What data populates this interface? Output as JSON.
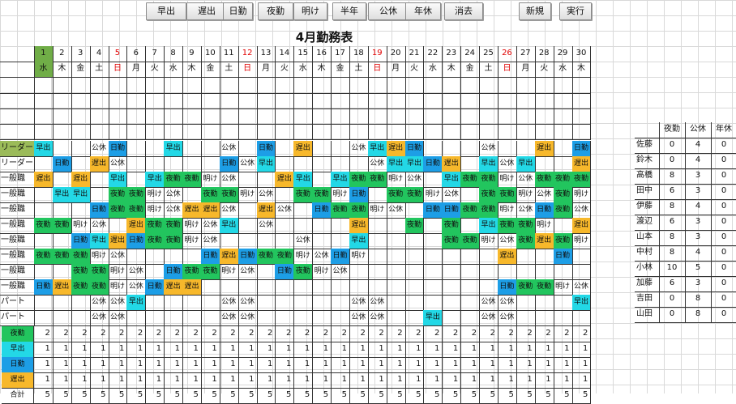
{
  "toolbar": {
    "buttons": [
      "早出",
      "遅出",
      "日勤",
      "夜勤",
      "明け",
      "半年",
      "公休",
      "年休",
      "消去",
      "新規",
      "実行"
    ]
  },
  "title": "4月勤務表",
  "days": [
    {
      "d": "1",
      "w": "水"
    },
    {
      "d": "2",
      "w": "木"
    },
    {
      "d": "3",
      "w": "金"
    },
    {
      "d": "4",
      "w": "土"
    },
    {
      "d": "5",
      "w": "日"
    },
    {
      "d": "6",
      "w": "月"
    },
    {
      "d": "7",
      "w": "火"
    },
    {
      "d": "8",
      "w": "水"
    },
    {
      "d": "9",
      "w": "木"
    },
    {
      "d": "10",
      "w": "金"
    },
    {
      "d": "11",
      "w": "土"
    },
    {
      "d": "12",
      "w": "日"
    },
    {
      "d": "13",
      "w": "月"
    },
    {
      "d": "14",
      "w": "火"
    },
    {
      "d": "15",
      "w": "水"
    },
    {
      "d": "16",
      "w": "木"
    },
    {
      "d": "17",
      "w": "金"
    },
    {
      "d": "18",
      "w": "土"
    },
    {
      "d": "19",
      "w": "日"
    },
    {
      "d": "20",
      "w": "月"
    },
    {
      "d": "21",
      "w": "火"
    },
    {
      "d": "22",
      "w": "水"
    },
    {
      "d": "23",
      "w": "木"
    },
    {
      "d": "24",
      "w": "金"
    },
    {
      "d": "25",
      "w": "土"
    },
    {
      "d": "26",
      "w": "日"
    },
    {
      "d": "27",
      "w": "月"
    },
    {
      "d": "28",
      "w": "火"
    },
    {
      "d": "29",
      "w": "水"
    },
    {
      "d": "30",
      "w": "木"
    }
  ],
  "colors": {
    "夜勤": "#22c55e",
    "早出": "#23d8e6",
    "日勤": "#1d9ee6",
    "遅出": "#f7b82b",
    "today": "#70ad47",
    "leader": "#9bbb59",
    "sunday": "#e00000"
  },
  "staff": [
    {
      "role": "リーダー",
      "shifts": [
        "早出",
        "",
        "",
        "公休",
        "日勤",
        "",
        "",
        "早出",
        "",
        "",
        "公休",
        "",
        "日勤",
        "",
        "遅出",
        "",
        "",
        "公休",
        "早出",
        "遅出",
        "日勤",
        "",
        "",
        "",
        "公休",
        "",
        "",
        "遅出",
        "",
        "日勤"
      ]
    },
    {
      "role": "リーダー",
      "shifts": [
        "",
        "日勤",
        "",
        "遅出",
        "公休",
        "",
        "",
        "",
        "",
        "",
        "日勤",
        "公休",
        "早出",
        "",
        "",
        "",
        "",
        "",
        "公休",
        "早出",
        "早出",
        "日勤",
        "遅出",
        "",
        "早出",
        "公休",
        "早出",
        "",
        "",
        "遅出"
      ]
    },
    {
      "role": "一般職",
      "shifts": [
        "遅出",
        "",
        "遅出",
        "",
        "早出",
        "",
        "早出",
        "夜勤",
        "夜勤",
        "明け",
        "公休",
        "",
        "",
        "遅出",
        "早出",
        "",
        "早出",
        "夜勤",
        "夜勤",
        "明け",
        "公休",
        "",
        "早出",
        "夜勤",
        "夜勤",
        "明け",
        "公休",
        "夜勤",
        "夜勤",
        "夜勤"
      ]
    },
    {
      "role": "一般職",
      "shifts": [
        "",
        "早出",
        "早出",
        "",
        "夜勤",
        "夜勤",
        "明け",
        "公休",
        "",
        "夜勤",
        "夜勤",
        "明け",
        "公休",
        "",
        "夜勤",
        "夜勤",
        "明け",
        "日勤",
        "",
        "夜勤",
        "夜勤",
        "明け",
        "公休",
        "",
        "夜勤",
        "夜勤",
        "明け",
        "公休",
        "夜勤",
        "明け"
      ]
    },
    {
      "role": "一般職",
      "shifts": [
        "",
        "",
        "",
        "日勤",
        "夜勤",
        "夜勤",
        "明け",
        "公休",
        "遅出",
        "遅出",
        "公休",
        "",
        "遅出",
        "公休",
        "",
        "日勤",
        "夜勤",
        "夜勤",
        "明け",
        "公休",
        "",
        "日勤",
        "日勤",
        "夜勤",
        "夜勤",
        "明け",
        "公休",
        "日勤",
        "夜勤",
        "公休"
      ]
    },
    {
      "role": "一般職",
      "shifts": [
        "夜勤",
        "夜勤",
        "明け",
        "公休",
        "",
        "遅出",
        "夜勤",
        "夜勤",
        "明け",
        "公休",
        "早出",
        "",
        "公休",
        "",
        "",
        "",
        "",
        "遅出",
        "",
        "",
        "夜勤",
        "",
        "夜勤",
        "",
        "早出",
        "夜勤",
        "夜勤",
        "明け",
        "",
        "遅出"
      ]
    },
    {
      "role": "一般職",
      "shifts": [
        "",
        "",
        "日勤",
        "早出",
        "遅出",
        "日勤",
        "夜勤",
        "夜勤",
        "明け",
        "公休",
        "",
        "",
        "",
        "",
        "公休",
        "",
        "",
        "早出",
        "",
        "",
        "",
        "",
        "夜勤",
        "夜勤",
        "明け",
        "公休",
        "夜勤",
        "遅出",
        "夜勤",
        "明け"
      ]
    },
    {
      "role": "一般職",
      "shifts": [
        "夜勤",
        "夜勤",
        "夜勤",
        "明け",
        "公休",
        "",
        "",
        "",
        "",
        "日勤",
        "遅出",
        "日勤",
        "夜勤",
        "夜勤",
        "明け",
        "公休",
        "日勤",
        "明け",
        "",
        "",
        "",
        "",
        "",
        "",
        "",
        "遅出",
        "",
        "",
        "日勤",
        ""
      ]
    },
    {
      "role": "一般職",
      "shifts": [
        "",
        "",
        "夜勤",
        "夜勤",
        "明け",
        "公休",
        "",
        "日勤",
        "夜勤",
        "夜勤",
        "明け",
        "公休",
        "",
        "日勤",
        "夜勤",
        "明け",
        "公休",
        "",
        "",
        "",
        "",
        "",
        "",
        "",
        "",
        "",
        "",
        "",
        "",
        ""
      ]
    },
    {
      "role": "一般職",
      "shifts": [
        "日勤",
        "遅出",
        "夜勤",
        "夜勤",
        "明け",
        "公休",
        "日勤",
        "遅出",
        "遅出",
        "",
        "",
        "",
        "",
        "",
        "",
        "",
        "",
        "",
        "",
        "",
        "",
        "",
        "",
        "",
        "",
        "日勤",
        "夜勤",
        "夜勤",
        "明け",
        "公休"
      ]
    },
    {
      "role": "パート",
      "shifts": [
        "",
        "",
        "",
        "公休",
        "公休",
        "早出",
        "",
        "",
        "",
        "",
        "公休",
        "公休",
        "",
        "",
        "",
        "",
        "",
        "公休",
        "公休",
        "",
        "",
        "",
        "",
        "",
        "公休",
        "公休",
        "",
        "",
        "",
        "早出"
      ]
    },
    {
      "role": "パート",
      "shifts": [
        "",
        "",
        "",
        "公休",
        "公休",
        "",
        "",
        "",
        "",
        "",
        "公休",
        "公休",
        "",
        "",
        "",
        "",
        "",
        "公休",
        "公休",
        "",
        "",
        "早出",
        "",
        "",
        "公休",
        "公休",
        "",
        "",
        "",
        ""
      ]
    }
  ],
  "summary": [
    {
      "label": "夜勤",
      "values": [
        "2",
        "2",
        "2",
        "2",
        "2",
        "2",
        "2",
        "2",
        "2",
        "2",
        "2",
        "2",
        "2",
        "2",
        "2",
        "2",
        "2",
        "2",
        "2",
        "2",
        "2",
        "2",
        "2",
        "2",
        "2",
        "2",
        "2",
        "2",
        "2",
        "2"
      ]
    },
    {
      "label": "早出",
      "values": [
        "1",
        "1",
        "1",
        "1",
        "1",
        "1",
        "1",
        "1",
        "1",
        "1",
        "1",
        "1",
        "1",
        "1",
        "1",
        "1",
        "1",
        "1",
        "1",
        "1",
        "1",
        "1",
        "1",
        "1",
        "1",
        "1",
        "1",
        "1",
        "1",
        "1"
      ]
    },
    {
      "label": "日勤",
      "values": [
        "1",
        "1",
        "1",
        "1",
        "1",
        "1",
        "1",
        "1",
        "1",
        "1",
        "1",
        "1",
        "1",
        "1",
        "1",
        "1",
        "1",
        "1",
        "1",
        "1",
        "1",
        "1",
        "1",
        "1",
        "1",
        "1",
        "1",
        "1",
        "1",
        "1"
      ]
    },
    {
      "label": "遅出",
      "values": [
        "1",
        "1",
        "1",
        "1",
        "1",
        "1",
        "1",
        "1",
        "1",
        "1",
        "1",
        "1",
        "1",
        "1",
        "1",
        "1",
        "1",
        "1",
        "1",
        "1",
        "1",
        "1",
        "1",
        "1",
        "1",
        "1",
        "1",
        "1",
        "1",
        "1"
      ]
    },
    {
      "label": "合計",
      "values": [
        "5",
        "5",
        "5",
        "5",
        "5",
        "5",
        "5",
        "5",
        "5",
        "5",
        "5",
        "5",
        "5",
        "5",
        "5",
        "5",
        "5",
        "5",
        "5",
        "5",
        "5",
        "5",
        "5",
        "5",
        "5",
        "5",
        "5",
        "5",
        "5",
        "5"
      ]
    }
  ],
  "side": {
    "headers": [
      "夜勤",
      "公休",
      "年休"
    ],
    "rows": [
      {
        "name": "佐藤",
        "v": [
          "0",
          "4",
          "0"
        ]
      },
      {
        "name": "鈴木",
        "v": [
          "0",
          "4",
          "0"
        ]
      },
      {
        "name": "高橋",
        "v": [
          "8",
          "3",
          "0"
        ]
      },
      {
        "name": "田中",
        "v": [
          "6",
          "3",
          "0"
        ]
      },
      {
        "name": "伊藤",
        "v": [
          "8",
          "4",
          "0"
        ]
      },
      {
        "name": "渡辺",
        "v": [
          "6",
          "3",
          "0"
        ]
      },
      {
        "name": "山本",
        "v": [
          "8",
          "3",
          "0"
        ]
      },
      {
        "name": "中村",
        "v": [
          "8",
          "4",
          "0"
        ]
      },
      {
        "name": "小林",
        "v": [
          "10",
          "5",
          "0"
        ]
      },
      {
        "name": "加藤",
        "v": [
          "6",
          "3",
          "0"
        ]
      },
      {
        "name": "吉田",
        "v": [
          "0",
          "8",
          "0"
        ]
      },
      {
        "name": "山田",
        "v": [
          "0",
          "8",
          "0"
        ]
      }
    ]
  }
}
